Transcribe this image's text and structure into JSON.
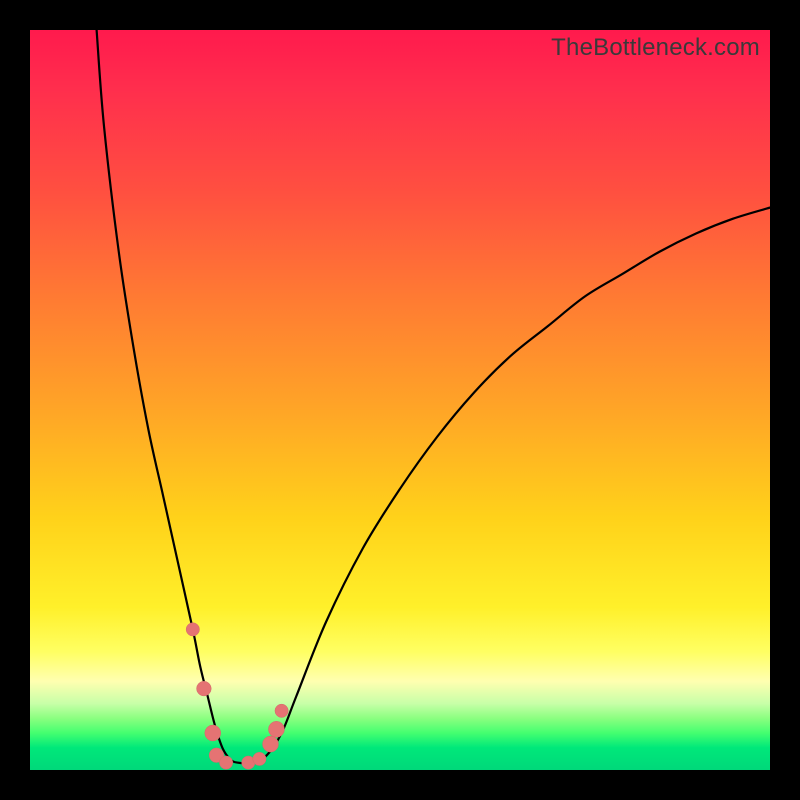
{
  "attribution": "TheBottleneck.com",
  "colors": {
    "frame": "#000000",
    "curve": "#000000",
    "marker_fill": "#e57373",
    "marker_stroke": "#d46a6a"
  },
  "chart_data": {
    "type": "line",
    "title": "",
    "xlabel": "",
    "ylabel": "",
    "xlim": [
      0,
      100
    ],
    "ylim": [
      0,
      100
    ],
    "grid": false,
    "series": [
      {
        "name": "curve",
        "x": [
          9,
          10,
          12,
          14,
          16,
          18,
          20,
          22,
          23,
          24,
          25,
          26,
          27,
          28,
          30,
          32,
          34,
          36,
          40,
          45,
          50,
          55,
          60,
          65,
          70,
          75,
          80,
          85,
          90,
          95,
          100
        ],
        "y": [
          100,
          87,
          70,
          57,
          46,
          37,
          28,
          19,
          14,
          10,
          6,
          3,
          1.5,
          1,
          1,
          2,
          5,
          10,
          20,
          30,
          38,
          45,
          51,
          56,
          60,
          64,
          67,
          70,
          72.5,
          74.5,
          76
        ]
      }
    ],
    "markers": [
      {
        "x": 22.0,
        "y": 19.0,
        "r": 1.0
      },
      {
        "x": 23.5,
        "y": 11.0,
        "r": 1.1
      },
      {
        "x": 24.7,
        "y": 5.0,
        "r": 1.2
      },
      {
        "x": 25.2,
        "y": 2.0,
        "r": 1.1
      },
      {
        "x": 26.5,
        "y": 1.0,
        "r": 1.0
      },
      {
        "x": 29.5,
        "y": 1.0,
        "r": 1.0
      },
      {
        "x": 31.0,
        "y": 1.5,
        "r": 1.0
      },
      {
        "x": 32.5,
        "y": 3.5,
        "r": 1.2
      },
      {
        "x": 33.3,
        "y": 5.5,
        "r": 1.2
      },
      {
        "x": 34.0,
        "y": 8.0,
        "r": 1.0
      }
    ]
  }
}
